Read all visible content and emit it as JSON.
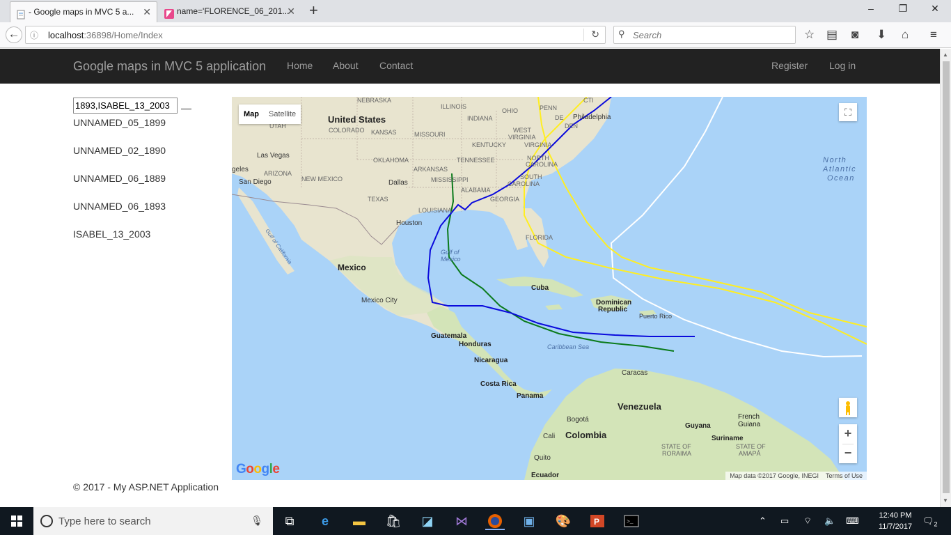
{
  "browser": {
    "tabs": [
      {
        "title": "- Google maps in MVC 5 a...",
        "active": true
      },
      {
        "title": "name='FLORENCE_06_201...",
        "active": false
      }
    ],
    "url_host": "localhost",
    "url_path": ":36898/Home/Index",
    "search_placeholder": "Search",
    "window_controls": [
      "minimize",
      "restore",
      "close"
    ]
  },
  "header": {
    "brand": "Google maps in MVC 5 application",
    "nav": [
      "Home",
      "About",
      "Contact"
    ],
    "account": [
      "Register",
      "Log in"
    ]
  },
  "sidebar": {
    "input_value": "1893,ISABEL_13_2003",
    "storms": [
      "UNNAMED_05_1899",
      "UNNAMED_02_1890",
      "UNNAMED_06_1889",
      "UNNAMED_06_1893",
      "ISABEL_13_2003"
    ]
  },
  "map": {
    "type_buttons": [
      "Map",
      "Satellite"
    ],
    "selected_type": "Map",
    "attribution": "Map data ©2017 Google, INEGI",
    "terms": "Terms of Use",
    "logo": "Google",
    "labels": {
      "ocean": [
        "North",
        "Atlantic",
        "Ocean"
      ],
      "us": "United States",
      "states": [
        "NEBRASKA",
        "ILLINOIS",
        "OHIO",
        "PENN",
        "UTAH",
        "COLORADO",
        "KANSAS",
        "MISSOURI",
        "INDIANA",
        "KENTUCKY",
        "WEST",
        "VIRGINIA",
        "VIRGINIA",
        "OKLAHOMA",
        "ARKANSAS",
        "TENNESSEE",
        "NORTH",
        "CAROLINA",
        "SOUTH",
        "CAROLINA",
        "ARIZONA",
        "NEW MEXICO",
        "MISSISSIPPI",
        "ALABAMA",
        "GEORGIA",
        "TEXAS",
        "LOUISIANA",
        "FLORIDA"
      ],
      "cities": [
        "Philadelphia",
        "Las Vegas",
        "geles",
        "San Diego",
        "Dallas",
        "Houston",
        "Mexico City",
        "Caracas",
        "Bogotá",
        "Cali",
        "Quito",
        "Puerto Rico"
      ],
      "countries": [
        "Mexico",
        "Cuba",
        "Dominican",
        "Republic",
        "Guatemala",
        "Honduras",
        "Nicaragua",
        "Costa Rica",
        "Panama",
        "Venezuela",
        "Colombia",
        "Guyana",
        "Suriname",
        "French",
        "Guiana",
        "Ecuador"
      ],
      "regions": [
        "STATE OF",
        "RORAIMA",
        "STATE OF",
        "AMAPÁ"
      ],
      "water": [
        "Gulf of",
        "Mexico",
        "Caribbean Sea",
        "Gulf of California"
      ],
      "partial": [
        "DEN",
        "DE",
        "CTI"
      ]
    },
    "tracks": [
      {
        "color": "#0000cc"
      },
      {
        "color": "#007700"
      },
      {
        "color": "#ffee22"
      },
      {
        "color": "#ffee22"
      },
      {
        "color": "#ffffff"
      }
    ]
  },
  "footer": "© 2017 - My ASP.NET Application",
  "taskbar": {
    "search_placeholder": "Type here to search",
    "time": "12:40 PM",
    "date": "11/7/2017",
    "notifications": "2"
  }
}
